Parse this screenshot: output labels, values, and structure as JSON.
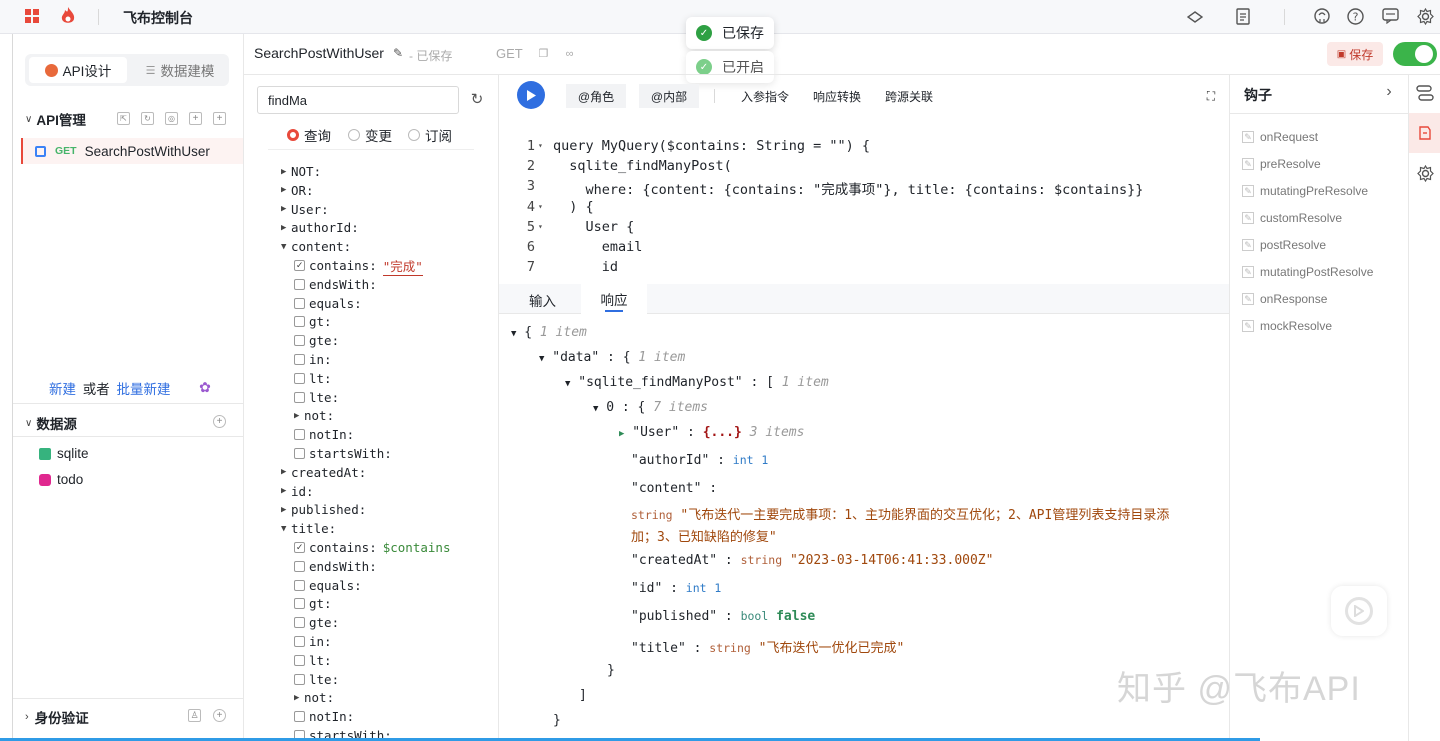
{
  "topbar": {
    "title": "飞布控制台"
  },
  "toasts": [
    {
      "text": "已保存"
    },
    {
      "text": "已开启"
    }
  ],
  "sidebar": {
    "tabs": [
      {
        "label": "API设计"
      },
      {
        "label": "数据建模"
      }
    ],
    "api_section": {
      "title": "API管理",
      "items": [
        {
          "method": "GET",
          "name": "SearchPostWithUser"
        }
      ]
    },
    "new_link": {
      "new": "新建",
      "or": "或者",
      "batch": "批量新建"
    },
    "datasource": {
      "title": "数据源",
      "items": [
        {
          "name": "sqlite",
          "color": "#36b37e"
        },
        {
          "name": "todo",
          "color": "#e0288f"
        }
      ]
    },
    "auth": {
      "title": "身份验证"
    }
  },
  "editor_header": {
    "name": "SearchPostWithUser",
    "status": "- 已保存",
    "method": "GET",
    "save_label": "保存"
  },
  "explorer": {
    "search_value": "findMa",
    "ops": [
      {
        "label": "查询",
        "selected": true
      },
      {
        "label": "变更",
        "selected": false
      },
      {
        "label": "订阅",
        "selected": false
      }
    ],
    "tree": [
      {
        "k": "NOT:",
        "d": 0,
        "t": "arrow"
      },
      {
        "k": "OR:",
        "d": 0,
        "t": "arrow"
      },
      {
        "k": "User:",
        "d": 0,
        "t": "arrow"
      },
      {
        "k": "authorId:",
        "d": 0,
        "t": "arrow"
      },
      {
        "k": "content:",
        "d": 0,
        "t": "open"
      },
      {
        "k": "contains:",
        "v": "\"完成\"",
        "vt": "str",
        "d": 1,
        "t": "checked"
      },
      {
        "k": "endsWith:",
        "d": 1,
        "t": "box"
      },
      {
        "k": "equals:",
        "d": 1,
        "t": "box"
      },
      {
        "k": "gt:",
        "d": 1,
        "t": "box"
      },
      {
        "k": "gte:",
        "d": 1,
        "t": "box"
      },
      {
        "k": "in:",
        "d": 1,
        "t": "box"
      },
      {
        "k": "lt:",
        "d": 1,
        "t": "box"
      },
      {
        "k": "lte:",
        "d": 1,
        "t": "box"
      },
      {
        "k": "not:",
        "d": 1,
        "t": "arrow"
      },
      {
        "k": "notIn:",
        "d": 1,
        "t": "box"
      },
      {
        "k": "startsWith:",
        "d": 1,
        "t": "box"
      },
      {
        "k": "createdAt:",
        "d": 0,
        "t": "arrow"
      },
      {
        "k": "id:",
        "d": 0,
        "t": "arrow"
      },
      {
        "k": "published:",
        "d": 0,
        "t": "arrow"
      },
      {
        "k": "title:",
        "d": 0,
        "t": "open"
      },
      {
        "k": "contains:",
        "v": "$contains",
        "vt": "var",
        "d": 1,
        "t": "checked"
      },
      {
        "k": "endsWith:",
        "d": 1,
        "t": "box"
      },
      {
        "k": "equals:",
        "d": 1,
        "t": "box"
      },
      {
        "k": "gt:",
        "d": 1,
        "t": "box"
      },
      {
        "k": "gte:",
        "d": 1,
        "t": "box"
      },
      {
        "k": "in:",
        "d": 1,
        "t": "box"
      },
      {
        "k": "lt:",
        "d": 1,
        "t": "box"
      },
      {
        "k": "lte:",
        "d": 1,
        "t": "box"
      },
      {
        "k": "not:",
        "d": 1,
        "t": "arrow"
      },
      {
        "k": "notIn:",
        "d": 1,
        "t": "box"
      },
      {
        "k": "startsWith:",
        "d": 1,
        "t": "box"
      }
    ]
  },
  "toolbar": {
    "role": "@角色",
    "internal": "@内部",
    "input_directive": "入参指令",
    "response_transform": "响应转换",
    "cross_source": "跨源关联"
  },
  "code": {
    "line_numbers": [
      "1",
      "2",
      "3",
      "4",
      "5",
      "6",
      "7"
    ],
    "lines": [
      "query MyQuery($contains: String = \"\") {",
      "  sqlite_findManyPost(",
      "    where: {content: {contains: \"完成事项\"}, title: {contains: $contains}}",
      "  ) {",
      "    User {",
      "      email",
      "      id"
    ]
  },
  "result_tabs": [
    {
      "label": "输入"
    },
    {
      "label": "响应"
    }
  ],
  "json": {
    "one_item": "1 item",
    "seven_items": "7 items",
    "three_items": "3 items",
    "data_key": "\"data\"",
    "query_key": "\"sqlite_findManyPost\"",
    "index0": "0",
    "user_key": "\"User\"",
    "user_collapsed": "{...}",
    "author_key": "\"authorId\"",
    "author_type": "int",
    "author_val": "1",
    "content_key": "\"content\"",
    "content_type": "string",
    "content_line1": "\"飞布迭代一主要完成事项：1、主功能界面的交互优化；2、API管理列表支持目录添",
    "content_line2": "加；3、已知缺陷的修复\"",
    "created_key": "\"createdAt\"",
    "created_type": "string",
    "created_val": "\"2023-03-14T06:41:33.000Z\"",
    "id_key": "\"id\"",
    "id_type": "int",
    "id_val": "1",
    "published_key": "\"published\"",
    "published_type": "bool",
    "published_val": "false",
    "title_key": "\"title\"",
    "title_type": "string",
    "title_val": "\"飞布迭代一优化已完成\""
  },
  "hooks": {
    "title": "钩子",
    "items": [
      "onRequest",
      "preResolve",
      "mutatingPreResolve",
      "customResolve",
      "postResolve",
      "mutatingPostResolve",
      "onResponse",
      "mockResolve"
    ]
  },
  "watermark": "知乎 @飞布API"
}
